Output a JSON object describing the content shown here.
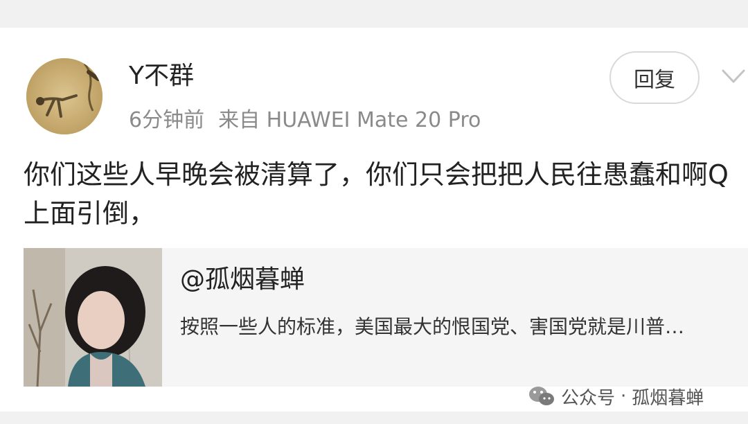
{
  "comment": {
    "username": "Y不群",
    "time": "6分钟前",
    "source": "来自 HUAWEI Mate 20 Pro",
    "reply_label": "回复",
    "text": "你们这些人早晚会被清算了，你们只会把把人民往愚蠢和啊Q上面引倒，"
  },
  "quote": {
    "user": "@孤烟暮蝉",
    "text": "按照一些人的标准，美国最大的恨国党、害国党就是川普…"
  },
  "watermark": {
    "platform": "公众号",
    "separator": "·",
    "account": "孤烟暮蝉"
  },
  "icons": {
    "more": "chevron-down-icon",
    "watermark": "wechat-icon"
  }
}
